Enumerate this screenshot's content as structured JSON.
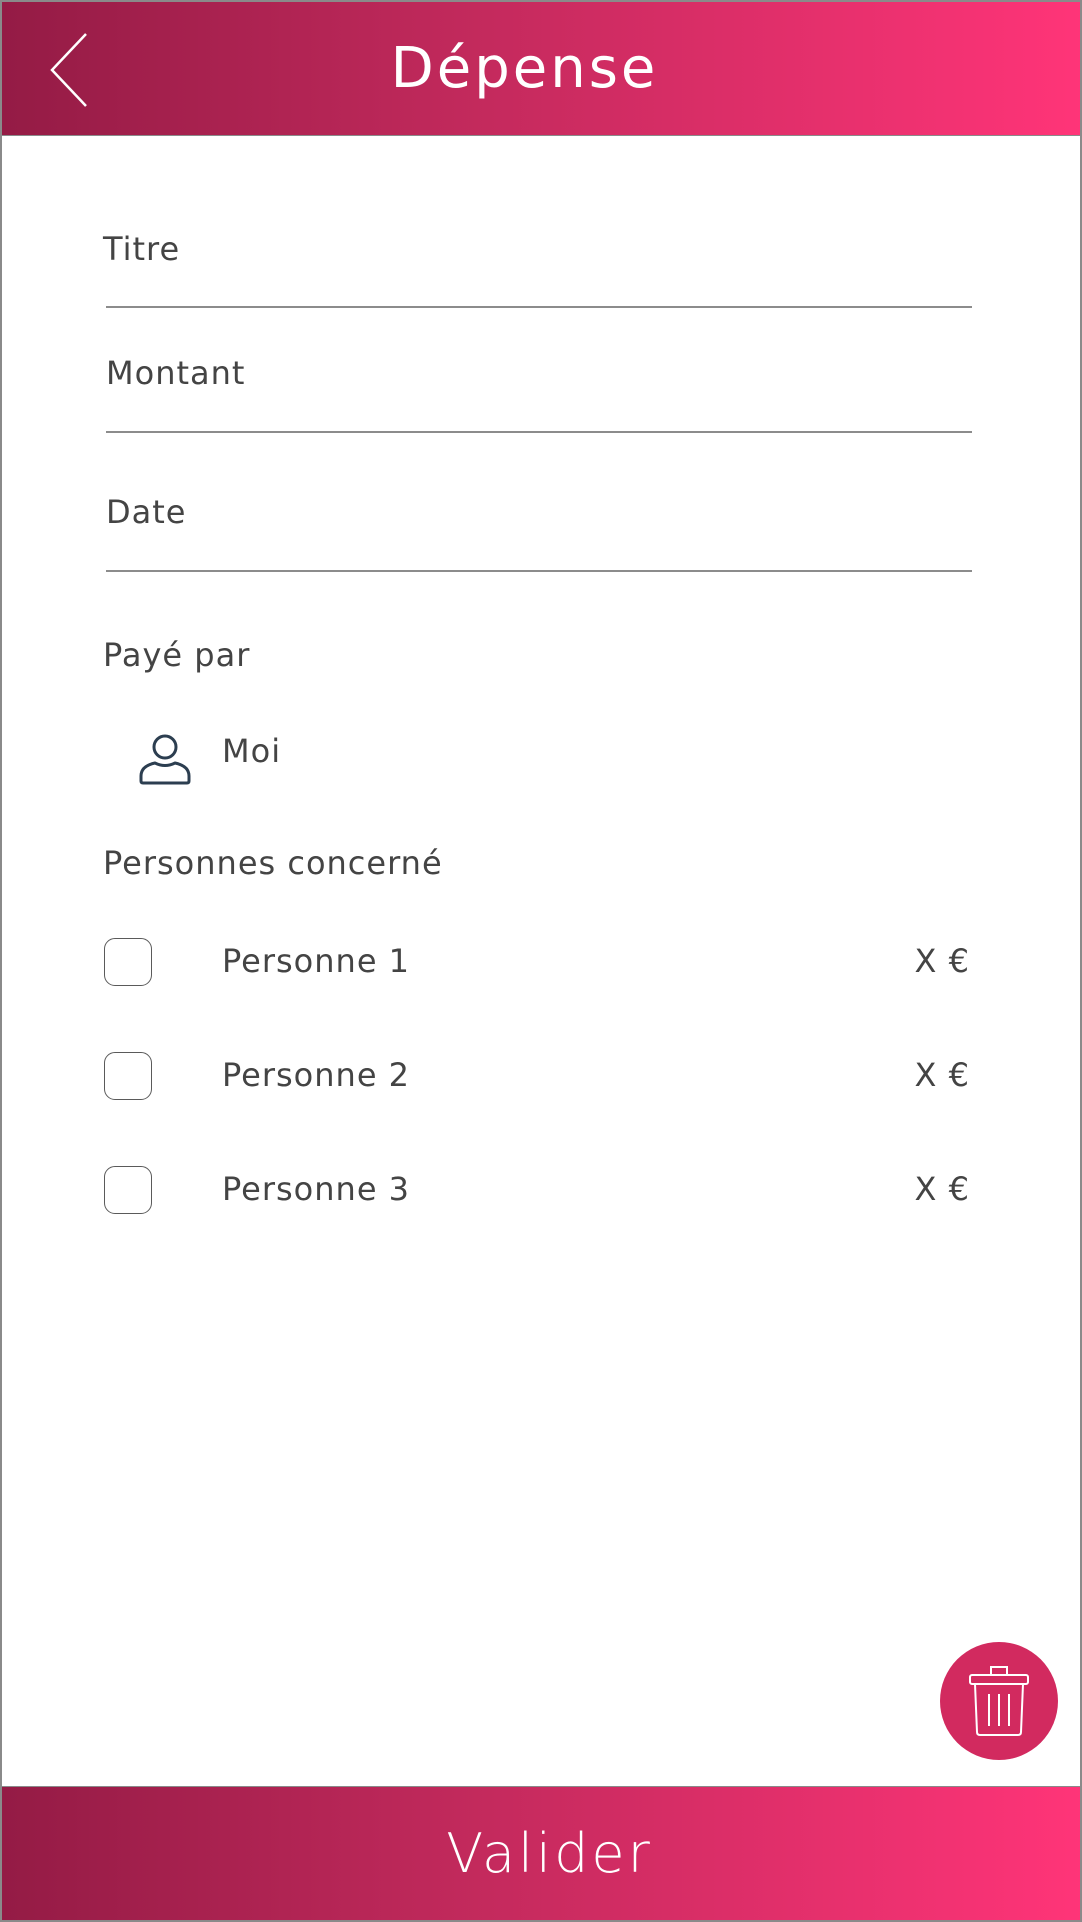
{
  "header": {
    "title": "Dépense",
    "back_icon": "chevron-left-icon"
  },
  "form": {
    "title_label": "Titre",
    "amount_label": "Montant",
    "date_label": "Date"
  },
  "paid_by": {
    "label": "Payé par",
    "icon": "user-icon",
    "name": "Moi"
  },
  "concerned": {
    "label": "Personnes concerné",
    "people": [
      {
        "name": "Personne 1",
        "amount": "X €",
        "checked": false
      },
      {
        "name": "Personne 2",
        "amount": "X €",
        "checked": false
      },
      {
        "name": "Personne 3",
        "amount": "X €",
        "checked": false
      }
    ]
  },
  "actions": {
    "delete_icon": "trash-icon",
    "validate_label": "Valider"
  },
  "colors": {
    "gradient_start": "#941b45",
    "gradient_end": "#ff3478",
    "fab": "#d22a5f"
  }
}
